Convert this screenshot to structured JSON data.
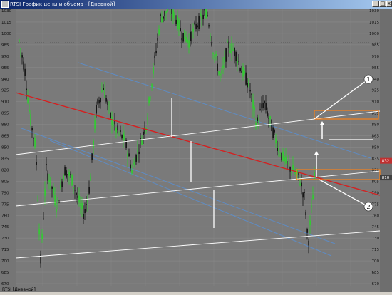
{
  "window": {
    "title": "RTSI График цены и объема - [Дневной]",
    "buttons": {
      "minimize": "_",
      "maximize": "□",
      "close": "x"
    }
  },
  "chart_data": {
    "type": "candlestick",
    "instrument": "RTSI",
    "timeframe_label": "RTSI [Дневной]",
    "ylim": [
      670,
      1030
    ],
    "y_ticks": [
      1030,
      1015,
      1000,
      985,
      970,
      955,
      940,
      925,
      910,
      895,
      880,
      865,
      850,
      835,
      820,
      805,
      790,
      775,
      760,
      745,
      730,
      715,
      700,
      685,
      670
    ],
    "left_labels": [
      1030,
      1015,
      1000,
      985,
      970,
      955,
      940,
      925,
      910,
      895,
      880,
      865,
      850,
      835,
      820,
      805,
      790,
      775,
      760,
      745,
      730,
      715,
      700,
      685,
      670
    ],
    "price_markers": [
      {
        "value": "832",
        "color": "#c03030"
      },
      {
        "value": "810",
        "color": "#404040"
      }
    ],
    "annotations": [
      "1",
      "2"
    ],
    "colors": {
      "background": "#7a7a7a",
      "grid": "#8c8c8c",
      "candles_up": "#22dd22",
      "candles_down": "#000000",
      "trend_red": "#d42020",
      "channel_blue": "#5a8fd0",
      "lines_white": "#ffffff",
      "highlight_box": "#f08020"
    }
  }
}
